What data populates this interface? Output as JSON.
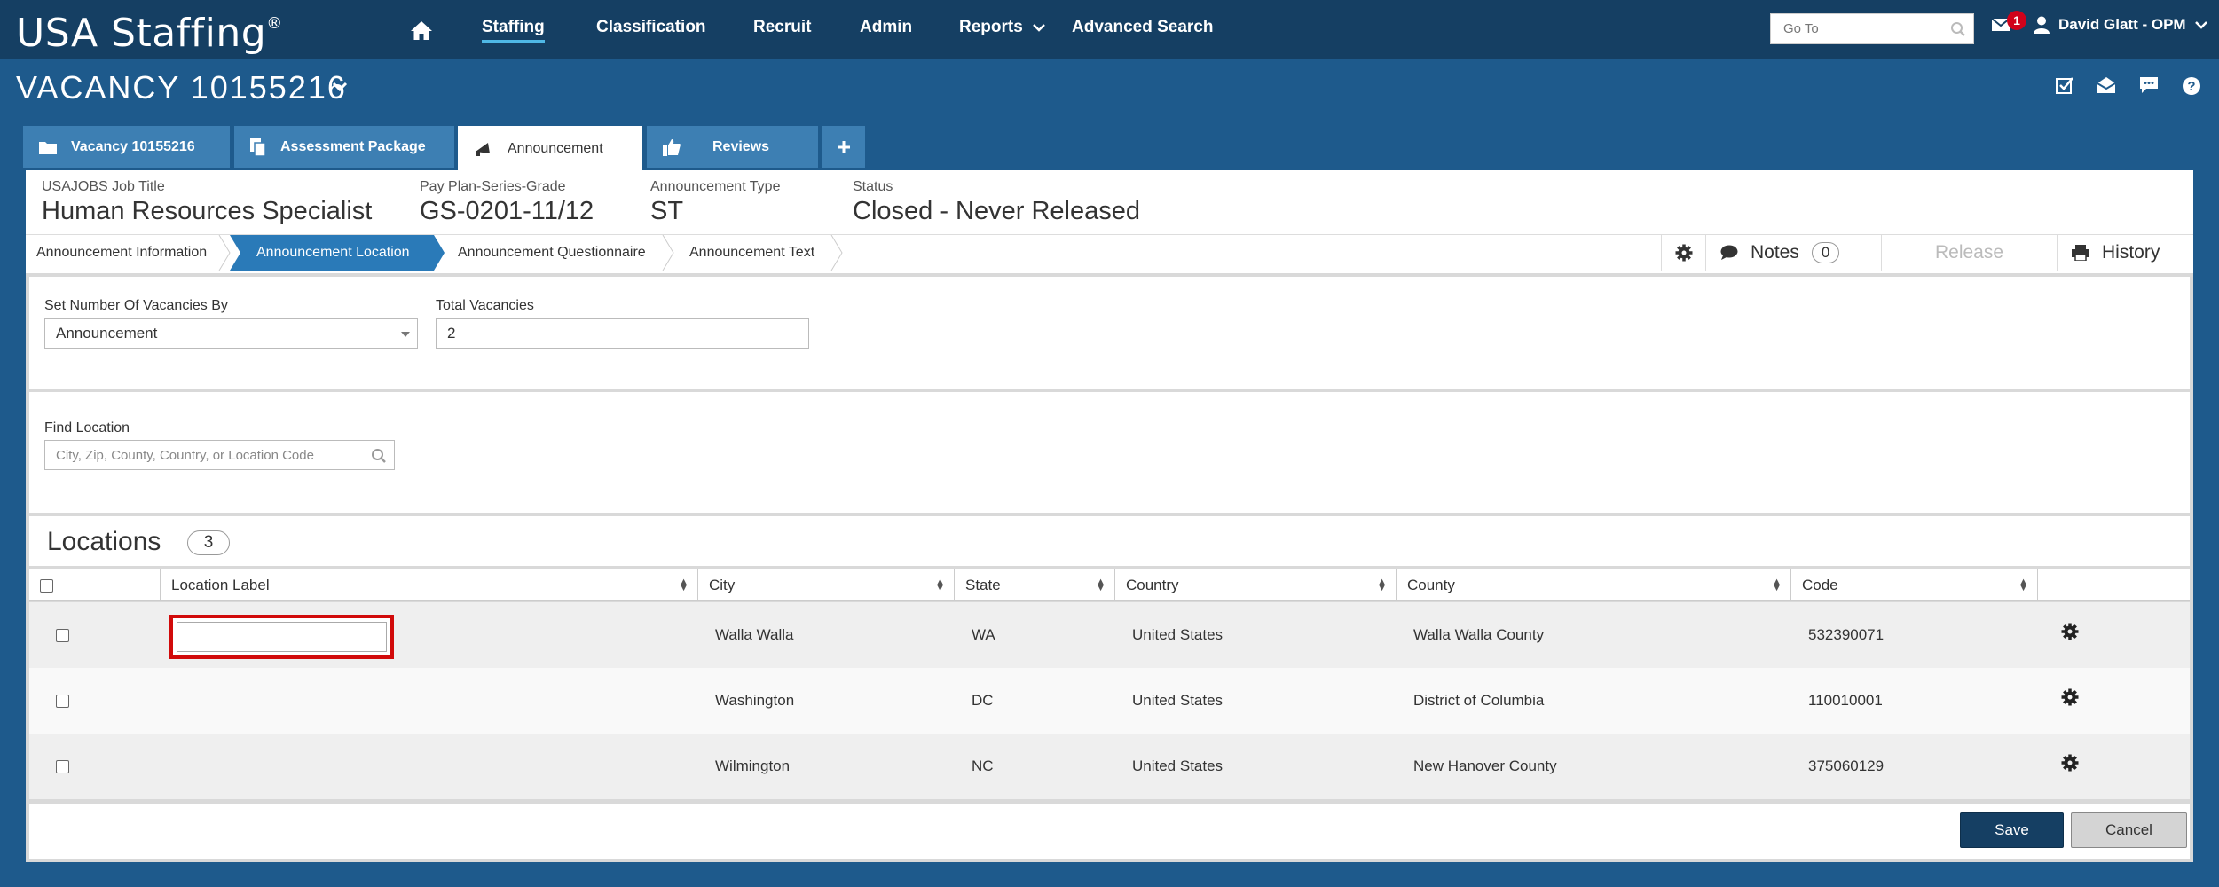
{
  "brand": {
    "name": "USA Staffing",
    "mark": "®"
  },
  "nav": {
    "items": [
      {
        "label": "Staffing",
        "active": true
      },
      {
        "label": "Classification"
      },
      {
        "label": "Recruit"
      },
      {
        "label": "Admin"
      },
      {
        "label": "Reports"
      },
      {
        "label": "Advanced Search"
      }
    ],
    "goto_placeholder": "Go To",
    "notifications": "1",
    "user": "David Glatt - OPM"
  },
  "vacancy": {
    "title": "VACANCY 10155216"
  },
  "tabs": [
    {
      "label": "Vacancy 10155216"
    },
    {
      "label": "Assessment Package"
    },
    {
      "label": "Announcement",
      "active": true
    },
    {
      "label": "Reviews"
    }
  ],
  "info": {
    "job_title_label": "USAJOBS Job Title",
    "job_title": "Human Resources Specialist",
    "grade_label": "Pay Plan-Series-Grade",
    "grade": "GS-0201-11/12",
    "type_label": "Announcement Type",
    "type": "ST",
    "status_label": "Status",
    "status": "Closed - Never Released"
  },
  "steps": [
    {
      "label": "Announcement Information"
    },
    {
      "label": "Announcement Location",
      "active": true
    },
    {
      "label": "Announcement Questionnaire"
    },
    {
      "label": "Announcement Text"
    }
  ],
  "actions": {
    "notes": "Notes",
    "notes_count": "0",
    "release": "Release",
    "history": "History"
  },
  "form": {
    "vacancies_by_label": "Set Number Of Vacancies By",
    "vacancies_by_value": "Announcement",
    "total_label": "Total Vacancies",
    "total_value": "2",
    "find_label": "Find Location",
    "find_placeholder": "City, Zip, County, Country, or Location Code"
  },
  "locations": {
    "title": "Locations",
    "count": "3",
    "columns": [
      "Location Label",
      "City",
      "State",
      "Country",
      "County",
      "Code"
    ],
    "rows": [
      {
        "city": "Walla Walla",
        "state": "WA",
        "country": "United States",
        "county": "Walla Walla County",
        "code": "532390071"
      },
      {
        "city": "Washington",
        "state": "DC",
        "country": "United States",
        "county": "District of Columbia",
        "code": "110010001"
      },
      {
        "city": "Wilmington",
        "state": "NC",
        "country": "United States",
        "county": "New Hanover County",
        "code": "375060129"
      }
    ]
  },
  "buttons": {
    "save": "Save",
    "cancel": "Cancel"
  },
  "colors": {
    "nav": "#153f63",
    "background": "#1e5a8c",
    "tab": "#3d7fb3",
    "active_step": "#2a7ab8",
    "highlight": "#d10a0a"
  }
}
